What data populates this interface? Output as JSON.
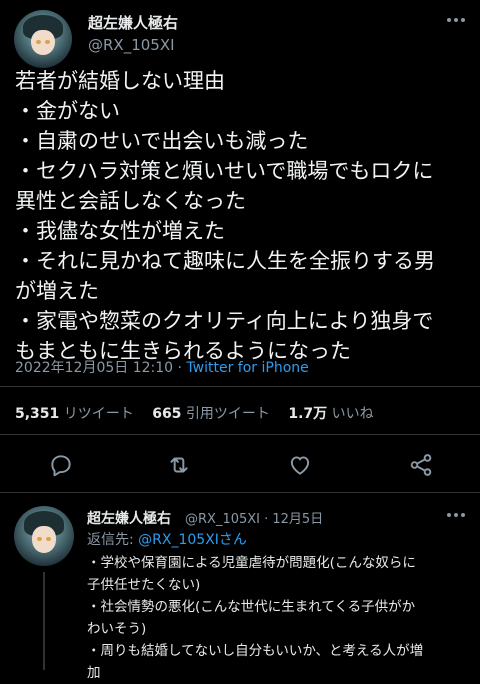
{
  "main_tweet": {
    "display_name": "超左嫌人極右",
    "handle": "@RX_105XI",
    "lines": [
      "若者が結婚しない理由",
      "・金がない",
      "・自粛のせいで出会いも減った",
      "・セクハラ対策と煩いせいで職場でもロクに",
      "異性と会話しなくなった",
      "・我儘な女性が増えた",
      "・それに見かねて趣味に人生を全振りする男",
      "が増えた",
      "・家電や惣菜のクオリティ向上により独身で",
      "もまともに生きられるようになった"
    ],
    "timestamp": "2022年12月05日 12:10",
    "separator": " · ",
    "source": "Twitter for iPhone",
    "stats": {
      "retweets_count": "5,351",
      "retweets_label": "リツイート",
      "quotes_count": "665",
      "quotes_label": "引用ツイート",
      "likes_count": "1.7万",
      "likes_label": "いいね"
    }
  },
  "actions": [
    "reply-icon",
    "retweet-icon",
    "like-icon",
    "share-icon"
  ],
  "reply": {
    "display_name": "超左嫌人極右",
    "meta": "@RX_105XI · 12月5日",
    "reply_to_label": "返信先: ",
    "reply_to_mention": "@RX_105XIさん",
    "lines": [
      "・学校や保育園による児童虐待が問題化(こんな奴らに",
      "子供任せたくない)",
      "・社会情勢の悪化(こんな世代に生まれてくる子供がか",
      "わいそう)",
      "・周りも結婚してないし自分もいいか、と考える人が増",
      "加"
    ]
  },
  "colors": {
    "background": "#000000",
    "text": "#e7e9ea",
    "secondary": "#8b98a5",
    "accent": "#2b9ef0",
    "divider": "#2f3336"
  }
}
